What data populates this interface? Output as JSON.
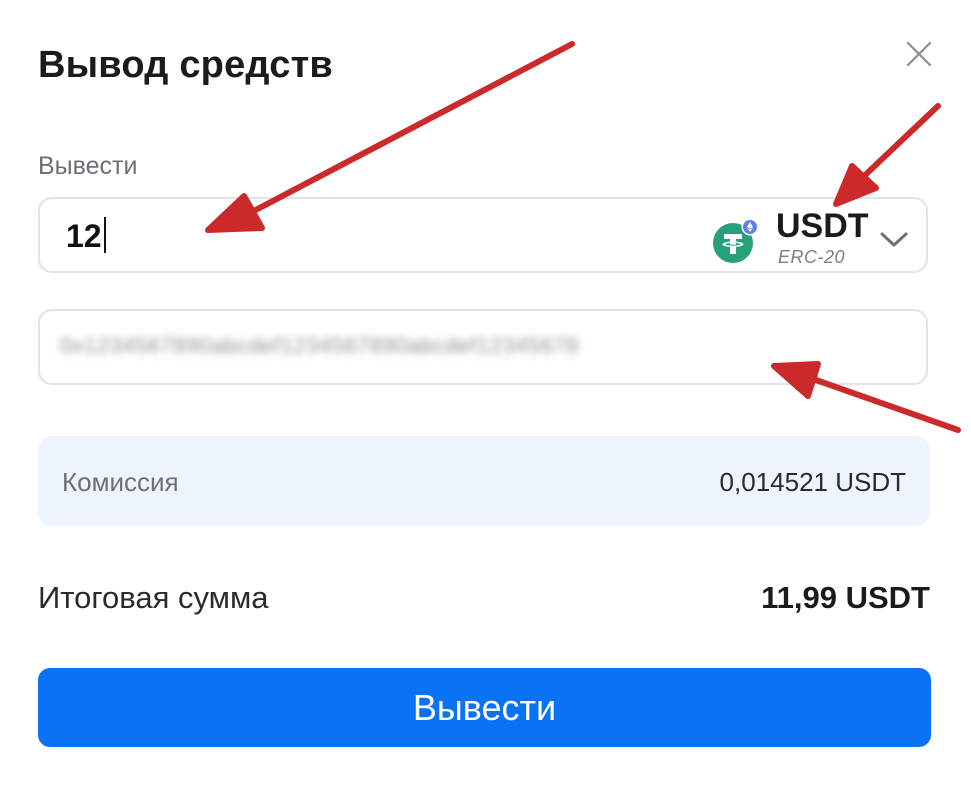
{
  "dialog": {
    "title": "Вывод средств"
  },
  "amount": {
    "label": "Вывести",
    "value": "12"
  },
  "token": {
    "name": "USDT",
    "network": "ERC-20",
    "icon": "tether-icon",
    "icon_color": "#26a17b",
    "network_badge_color": "#627eea"
  },
  "address": {
    "value": "0x1234567890abcdef1234567890abcdef12345678"
  },
  "fee": {
    "label": "Комиссия",
    "value": "0,014521 USDT"
  },
  "total": {
    "label": "Итоговая сумма",
    "value": "11,99 USDT"
  },
  "submit": {
    "label": "Вывести",
    "color": "#0a72f5"
  },
  "annotation": {
    "arrow_color": "#cc2a2a"
  }
}
